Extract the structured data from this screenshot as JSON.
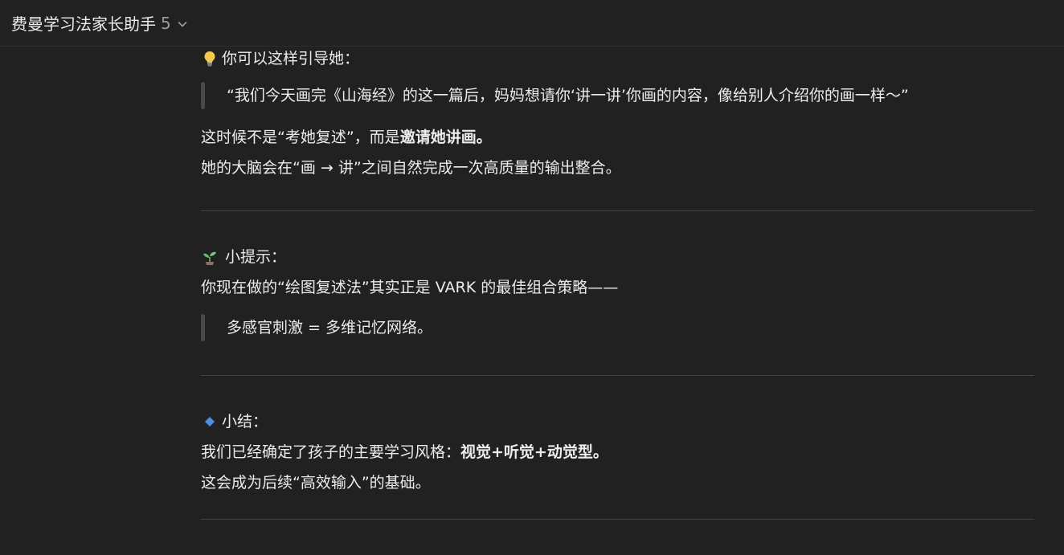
{
  "header": {
    "title": "费曼学习法家长助手",
    "version": "5",
    "chevron_icon": "chevron-down-icon"
  },
  "section1": {
    "icon": "lightbulb-icon",
    "heading": "你可以这样引导她：",
    "quote": "“我们今天画完《山海经》的这一篇后，妈妈想请你‘讲一讲’你画的内容，像给别人介绍你的画一样～”",
    "line1_prefix": "这时候不是“考她复述”，而是",
    "line1_bold": "邀请她讲画。",
    "line2": "她的大脑会在“画 → 讲”之间自然完成一次高质量的输出整合。"
  },
  "section2": {
    "icon": "seedling-icon",
    "heading": "小提示：",
    "line1": "你现在做的“绘图复述法”其实正是 VARK 的最佳组合策略——",
    "quote": "多感官刺激 = 多维记忆网络。"
  },
  "section3": {
    "icon": "blue-diamond-icon",
    "heading": "小结：",
    "line1_prefix": "我们已经确定了孩子的主要学习风格：",
    "line1_bold": "视觉+听觉+动觉型。",
    "line2": "这会成为后续“高效输入”的基础。"
  },
  "colors": {
    "background": "#212121",
    "text": "#ececec",
    "muted": "#9b9b9b",
    "divider": "#424242",
    "quote_bar": "#4a4a4a"
  }
}
